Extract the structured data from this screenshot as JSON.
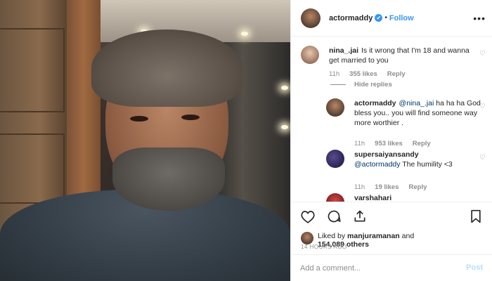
{
  "post": {
    "author": "actormaddy",
    "verified_glyph": "✔",
    "separator": "•",
    "follow_label": "Follow",
    "more_label": "•••"
  },
  "comments": [
    {
      "username": "nina_.jai",
      "text": "Is it wrong that I'm 18 and wanna get married to you",
      "time": "11h",
      "likes": "355 likes",
      "reply_label": "Reply",
      "hide_replies_label": "Hide replies"
    },
    {
      "username": "actormaddy",
      "mention": "@nina_.jai",
      "text": "ha ha ha God bless you.. you will find someone way more worthier .",
      "time": "11h",
      "likes": "953 likes",
      "reply_label": "Reply"
    },
    {
      "username": "supersaiyansandy",
      "mention": "@actormaddy",
      "text": "The humility <3",
      "time": "11h",
      "likes": "19 likes",
      "reply_label": "Reply"
    },
    {
      "username": "varshahari"
    }
  ],
  "likes_summary": {
    "prefix": "Liked by",
    "user": "manjuramanan",
    "conjunction": "and",
    "others": "154,089 others"
  },
  "timestamp": "14 HOURS AGO",
  "comment_box": {
    "placeholder": "Add a comment...",
    "post_label": "Post"
  },
  "icons": {
    "like": "heart-icon",
    "comment": "comment-bubble-icon",
    "share": "share-icon",
    "save": "bookmark-icon"
  },
  "colors": {
    "accent": "#3897f0",
    "post_disabled": "#b2dffc",
    "muted": "#8e8e8e",
    "text": "#262626"
  }
}
